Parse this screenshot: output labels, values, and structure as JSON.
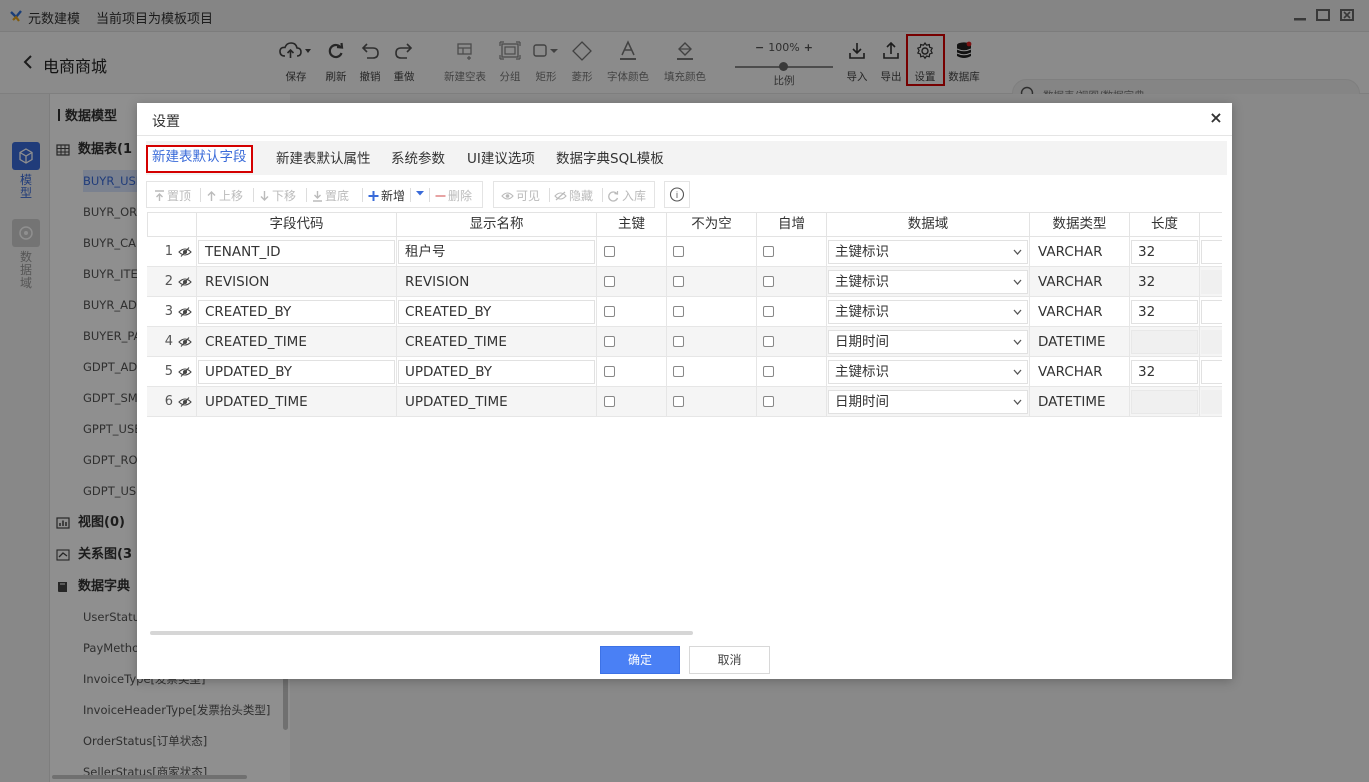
{
  "titlebar": {
    "app_name": "元数建模",
    "project_info": "当前项目为模板项目"
  },
  "toolbar": {
    "back_label": "电商商城",
    "buttons": {
      "save": "保存",
      "refresh": "刷新",
      "undo": "撤销",
      "redo": "重做",
      "new_table": "新建空表",
      "group": "分组",
      "rect": "矩形",
      "diamond": "菱形",
      "font_color": "字体颜色",
      "fill_color": "填充颜色",
      "zoom_label": "比例",
      "import": "导入",
      "export": "导出",
      "settings": "设置",
      "database": "数据库"
    },
    "zoom_value": "100%",
    "search_placeholder": "数据表/视图/数据字典"
  },
  "rail": {
    "model": "模型",
    "domain": "数据域"
  },
  "tree": {
    "title": "数据模型",
    "tables_header": "数据表(1",
    "tables": [
      "BUYR_USE",
      "BUYR_ORD",
      "BUYR_CAR",
      "BUYR_ITEN",
      "BUYR_ADD",
      "BUYER_PA",
      "GDPT_ADV",
      "GDPT_SMS",
      "GPPT_USE",
      "GDPT_ROL",
      "GDPT_USE"
    ],
    "views_header": "视图(0)",
    "relations_header": "关系图(3",
    "dict_header": "数据字典",
    "dicts": [
      "UserStatus",
      "PayMetho",
      "InvoiceType[发票类型]",
      "InvoiceHeaderType[发票抬头类型]",
      "OrderStatus[订单状态]",
      "SellerStatus[商家状态]"
    ]
  },
  "dialog": {
    "title": "设置",
    "close": "×",
    "tabs": [
      "新建表默认字段",
      "新建表默认属性",
      "系统参数",
      "UI建议选项",
      "数据字典SQL模板"
    ],
    "active_tab": 0,
    "table_toolbar": {
      "top": "置顶",
      "up": "上移",
      "down": "下移",
      "bottom": "置底",
      "add": "新增",
      "delete": "删除",
      "visible": "可见",
      "hide": "隐藏",
      "to_lib": "入库",
      "info": "i"
    },
    "columns": [
      "字段代码",
      "显示名称",
      "主键",
      "不为空",
      "自增",
      "数据域",
      "数据类型",
      "长度"
    ],
    "rows": [
      {
        "n": "1",
        "code": "TENANT_ID",
        "name": "租户号",
        "pk": false,
        "nn": false,
        "ai": false,
        "domain": "主键标识",
        "dtype": "VARCHAR",
        "len": "32"
      },
      {
        "n": "2",
        "code": "REVISION",
        "name": "REVISION",
        "pk": false,
        "nn": false,
        "ai": false,
        "domain": "主键标识",
        "dtype": "VARCHAR",
        "len": "32"
      },
      {
        "n": "3",
        "code": "CREATED_BY",
        "name": "CREATED_BY",
        "pk": false,
        "nn": false,
        "ai": false,
        "domain": "主键标识",
        "dtype": "VARCHAR",
        "len": "32"
      },
      {
        "n": "4",
        "code": "CREATED_TIME",
        "name": "CREATED_TIME",
        "pk": false,
        "nn": false,
        "ai": false,
        "domain": "日期时间",
        "dtype": "DATETIME",
        "len": ""
      },
      {
        "n": "5",
        "code": "UPDATED_BY",
        "name": "UPDATED_BY",
        "pk": false,
        "nn": false,
        "ai": false,
        "domain": "主键标识",
        "dtype": "VARCHAR",
        "len": "32"
      },
      {
        "n": "6",
        "code": "UPDATED_TIME",
        "name": "UPDATED_TIME",
        "pk": false,
        "nn": false,
        "ai": false,
        "domain": "日期时间",
        "dtype": "DATETIME",
        "len": ""
      }
    ],
    "ok": "确定",
    "cancel": "取消"
  },
  "colors": {
    "accent": "#4a80f5",
    "highlight_border": "#d40000",
    "selected_text": "#3a6bd9"
  }
}
